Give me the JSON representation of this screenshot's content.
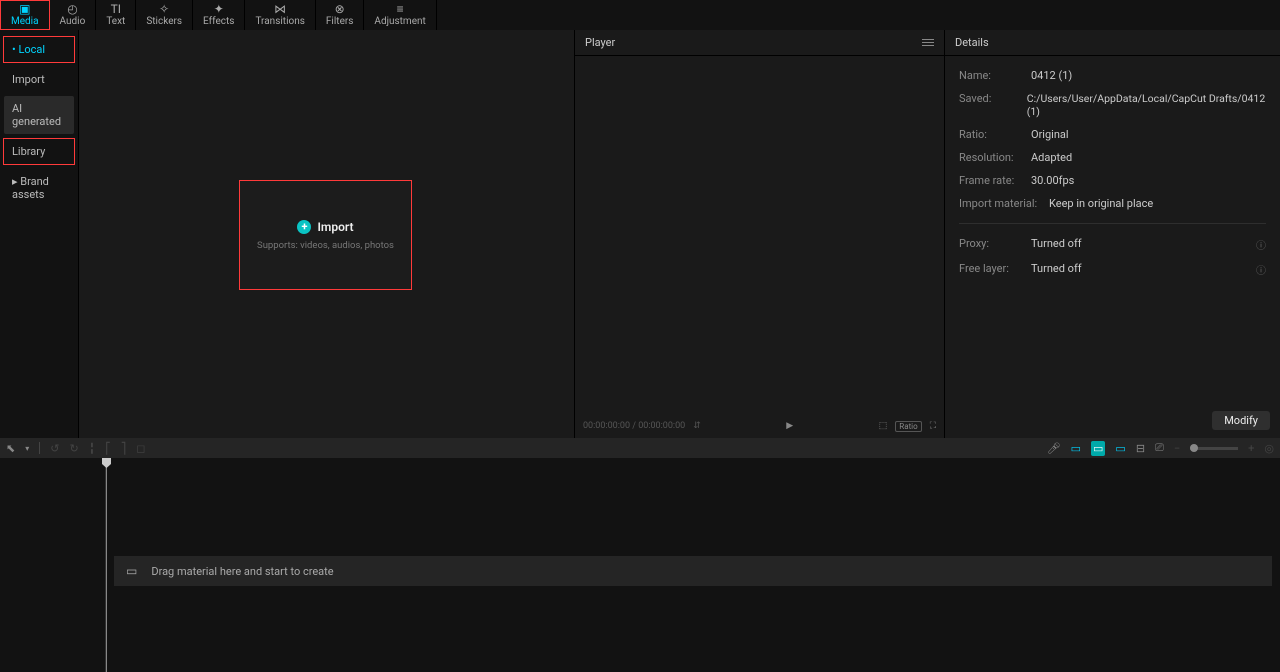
{
  "top_tabs": {
    "media": "Media",
    "audio": "Audio",
    "text": "Text",
    "stickers": "Stickers",
    "effects": "Effects",
    "transitions": "Transitions",
    "filters": "Filters",
    "adjustment": "Adjustment"
  },
  "sidebar": {
    "local": "Local",
    "import": "Import",
    "ai_generated": "AI generated",
    "library": "Library",
    "brand_assets": "Brand assets"
  },
  "import_box": {
    "label": "Import",
    "sub": "Supports: videos, audios, photos"
  },
  "player": {
    "title": "Player",
    "time_current": "00:00:00:00",
    "time_sep": " / ",
    "time_total": "00:00:00:00",
    "ratio_badge": "Ratio"
  },
  "details": {
    "title": "Details",
    "name_label": "Name:",
    "name_value": "0412 (1)",
    "saved_label": "Saved:",
    "saved_value": "C:/Users/User/AppData/Local/CapCut Drafts/0412 (1)",
    "ratio_label": "Ratio:",
    "ratio_value": "Original",
    "resolution_label": "Resolution:",
    "resolution_value": "Adapted",
    "framerate_label": "Frame rate:",
    "framerate_value": "30.00fps",
    "importmat_label": "Import material:",
    "importmat_value": "Keep in original place",
    "proxy_label": "Proxy:",
    "proxy_value": "Turned off",
    "freelayer_label": "Free layer:",
    "freelayer_value": "Turned off",
    "modify": "Modify"
  },
  "timeline": {
    "drag_hint": "Drag material here and start to create"
  }
}
